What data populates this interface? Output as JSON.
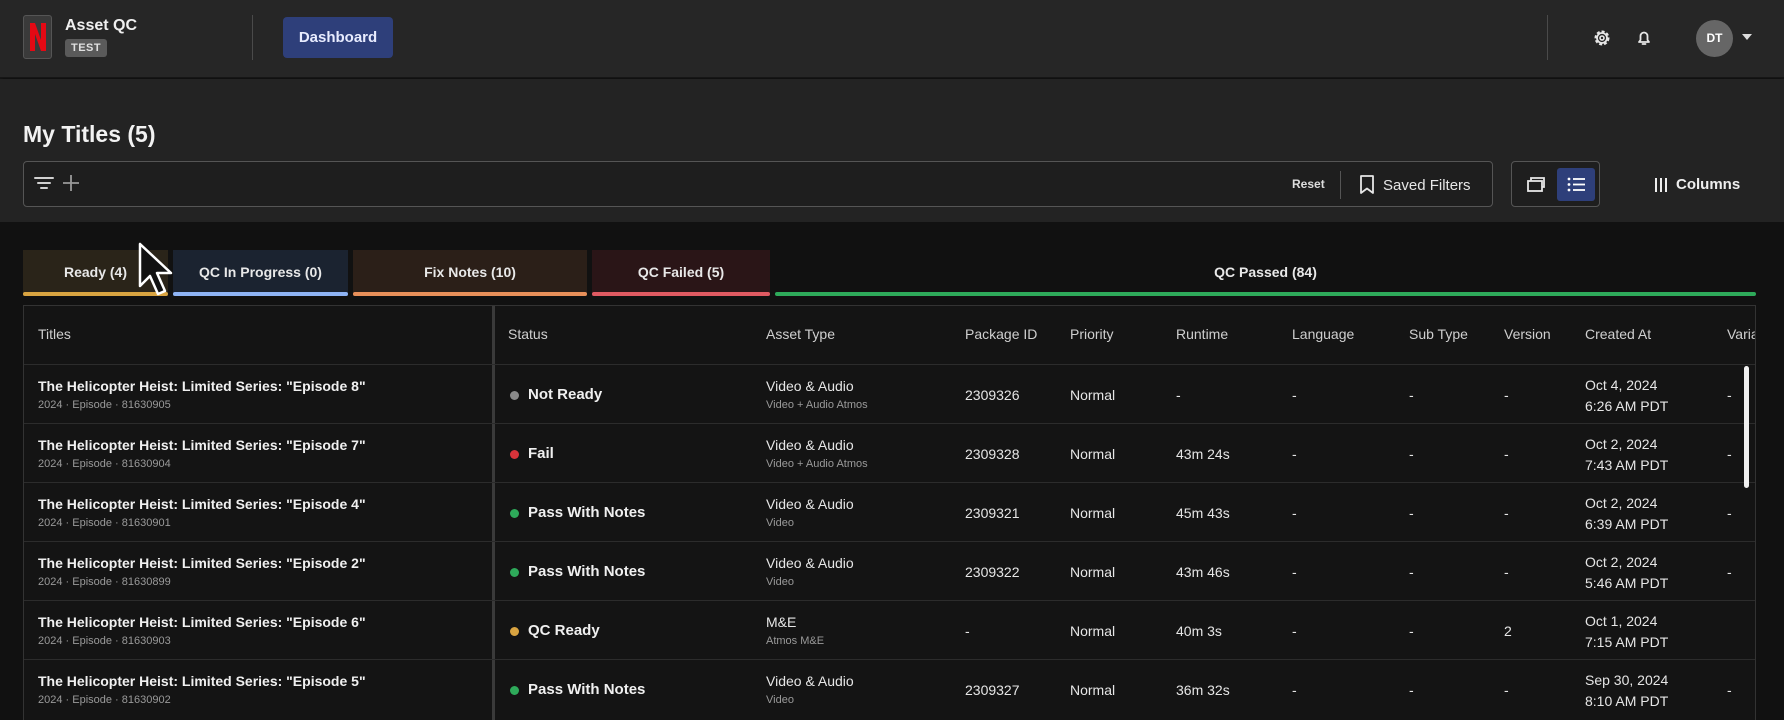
{
  "app": {
    "title": "Asset QC",
    "env_badge": "TEST"
  },
  "nav": {
    "dashboard_label": "Dashboard"
  },
  "user": {
    "initials": "DT"
  },
  "page": {
    "title": "My Titles (5)"
  },
  "filters": {
    "reset_label": "Reset",
    "saved_label": "Saved Filters",
    "columns_label": "Columns"
  },
  "tabs": [
    {
      "label": "Ready (4)",
      "color": "#d9a441"
    },
    {
      "label": "QC In Progress (0)",
      "color": "#8fb4f5"
    },
    {
      "label": "Fix Notes (10)",
      "color": "#e8905a"
    },
    {
      "label": "QC Failed (5)",
      "color": "#e05a62"
    },
    {
      "label": "QC Passed (84)",
      "color": "#2eaa5a"
    }
  ],
  "columns": [
    "Titles",
    "Status",
    "Asset Type",
    "Package ID",
    "Priority",
    "Runtime",
    "Language",
    "Sub Type",
    "Version",
    "Created At",
    "Varia"
  ],
  "status_colors": {
    "Not Ready": "#8a8a8a",
    "Fail": "#d8333a",
    "Pass With Notes": "#2eaa5a",
    "QC Ready": "#d9a441"
  },
  "rows": [
    {
      "title": "The Helicopter Heist: Limited Series: \"Episode 8\"",
      "meta": "2024 · Episode · 81630905",
      "status": "Not Ready",
      "asset_type": "Video & Audio",
      "asset_sub": "Video + Audio Atmos",
      "package_id": "2309326",
      "priority": "Normal",
      "runtime": "-",
      "language": "-",
      "sub_type": "-",
      "version": "-",
      "created_date": "Oct 4, 2024",
      "created_time": "6:26 AM PDT",
      "varia": "-"
    },
    {
      "title": "The Helicopter Heist: Limited Series: \"Episode 7\"",
      "meta": "2024 · Episode · 81630904",
      "status": "Fail",
      "asset_type": "Video & Audio",
      "asset_sub": "Video + Audio Atmos",
      "package_id": "2309328",
      "priority": "Normal",
      "runtime": "43m 24s",
      "language": "-",
      "sub_type": "-",
      "version": "-",
      "created_date": "Oct 2, 2024",
      "created_time": "7:43 AM PDT",
      "varia": "-"
    },
    {
      "title": "The Helicopter Heist: Limited Series: \"Episode 4\"",
      "meta": "2024 · Episode · 81630901",
      "status": "Pass With Notes",
      "asset_type": "Video & Audio",
      "asset_sub": "Video",
      "package_id": "2309321",
      "priority": "Normal",
      "runtime": "45m 43s",
      "language": "-",
      "sub_type": "-",
      "version": "-",
      "created_date": "Oct 2, 2024",
      "created_time": "6:39 AM PDT",
      "varia": "-"
    },
    {
      "title": "The Helicopter Heist: Limited Series: \"Episode 2\"",
      "meta": "2024 · Episode · 81630899",
      "status": "Pass With Notes",
      "asset_type": "Video & Audio",
      "asset_sub": "Video",
      "package_id": "2309322",
      "priority": "Normal",
      "runtime": "43m 46s",
      "language": "-",
      "sub_type": "-",
      "version": "-",
      "created_date": "Oct 2, 2024",
      "created_time": "5:46 AM PDT",
      "varia": "-"
    },
    {
      "title": "The Helicopter Heist: Limited Series: \"Episode 6\"",
      "meta": "2024 · Episode · 81630903",
      "status": "QC Ready",
      "asset_type": "M&E",
      "asset_sub": "Atmos M&E",
      "package_id": "-",
      "priority": "Normal",
      "runtime": "40m 3s",
      "language": "-",
      "sub_type": "-",
      "version": "2",
      "created_date": "Oct 1, 2024",
      "created_time": "7:15 AM PDT",
      "varia": ""
    },
    {
      "title": "The Helicopter Heist: Limited Series: \"Episode 5\"",
      "meta": "2024 · Episode · 81630902",
      "status": "Pass With Notes",
      "asset_type": "Video & Audio",
      "asset_sub": "Video",
      "package_id": "2309327",
      "priority": "Normal",
      "runtime": "36m 32s",
      "language": "-",
      "sub_type": "-",
      "version": "-",
      "created_date": "Sep 30, 2024",
      "created_time": "8:10 AM PDT",
      "varia": "-"
    }
  ]
}
